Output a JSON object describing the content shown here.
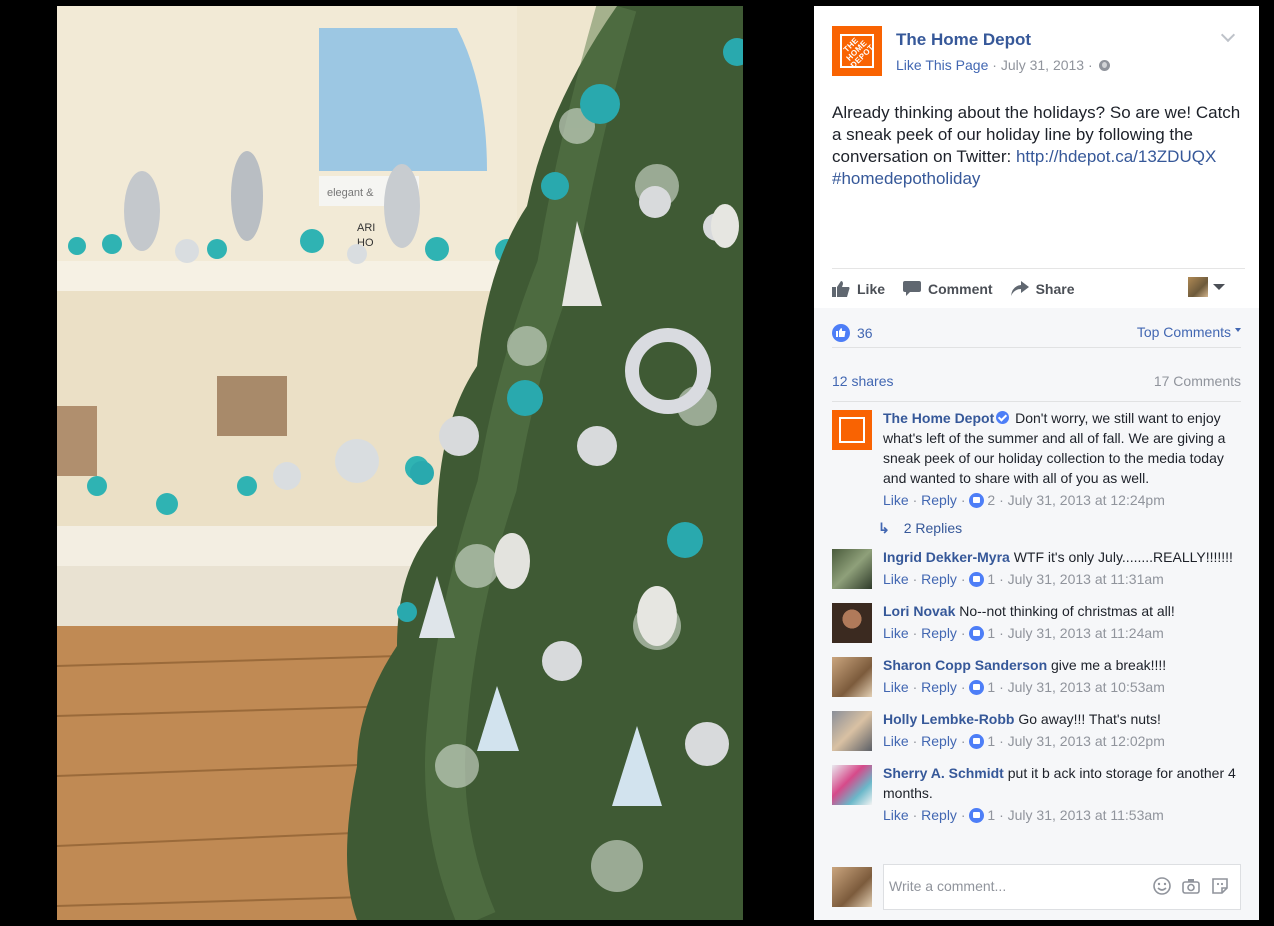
{
  "post": {
    "page_name": "The Home Depot",
    "like_page": "Like This Page",
    "separator": " · ",
    "date": "July 31, 2013",
    "text_line": "Already thinking about the holidays? So are we! Catch a sneak peek of our holiday line by following the conversation on Twitter:",
    "link": "http://hdepot.ca/13ZDUQX",
    "hashtag": "#homedepotholiday"
  },
  "actions": {
    "like": "Like",
    "comment": "Comment",
    "share": "Share"
  },
  "feedback": {
    "reaction_count": "36",
    "top_comments": "Top Comments",
    "shares": "12 shares",
    "comment_count": "17 Comments"
  },
  "comments": [
    {
      "name": "The Home Depot",
      "text": "Don't worry, we still want to enjoy what's left of the summer and all of fall. We are giving a sneak peek of our holiday collection to the media today and wanted to share with all of you as well.",
      "likes": "2",
      "time": "July 31, 2013 at 12:24pm",
      "replies": "2 Replies"
    },
    {
      "name": "Ingrid Dekker-Myra",
      "text": "WTF it's only July........REALLY!!!!!!!",
      "likes": "1",
      "time": "July 31, 2013 at 11:31am"
    },
    {
      "name": "Lori Novak",
      "text": "No--not thinking of christmas at all!",
      "likes": "1",
      "time": "July 31, 2013 at 11:24am"
    },
    {
      "name": "Sharon Copp Sanderson",
      "text": "give me a break!!!!",
      "likes": "1",
      "time": "July 31, 2013 at 10:53am"
    },
    {
      "name": "Holly Lembke-Robb",
      "text": "Go away!!! That's nuts!",
      "likes": "1",
      "time": "July 31, 2013 at 12:02pm"
    },
    {
      "name": "Sherry A. Schmidt",
      "text": "put it b ack into storage for another 4 months.",
      "likes": "1",
      "time": "July 31, 2013 at 11:53am"
    }
  ],
  "comment_actions": {
    "like": "Like",
    "reply": "Reply",
    "sep": " · "
  },
  "write_comment": {
    "placeholder": "Write a comment..."
  },
  "photo": {
    "logo_text": "THE HOME DEPOT",
    "sign_text_1": "elegant &",
    "sign_text_2": "ARI",
    "sign_text_3": "HO"
  },
  "colors": {
    "accent": "#4267b2",
    "brand": "#f96302",
    "link": "#365899"
  }
}
